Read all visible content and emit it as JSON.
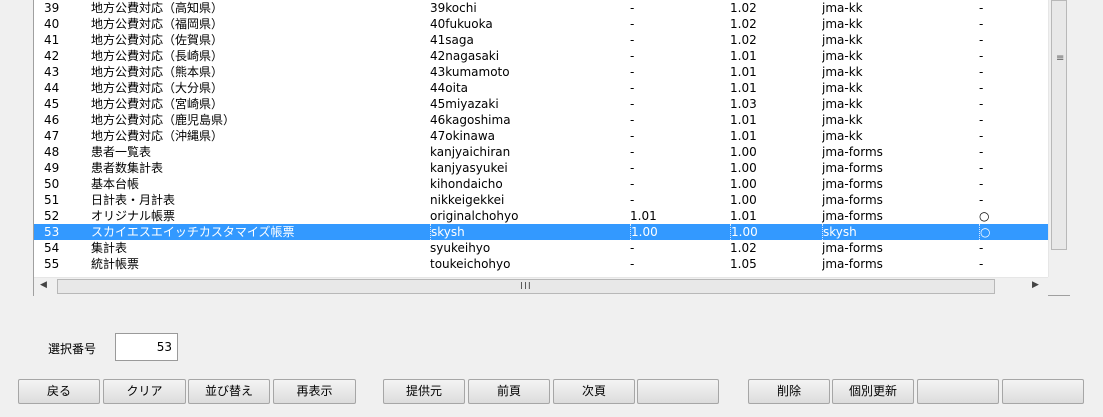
{
  "table": {
    "rows": [
      {
        "no": "39",
        "name": "地方公費対応（高知県）",
        "code": "39kochi",
        "v1": "-",
        "v2": "1.02",
        "type": "jma-kk",
        "mark": "-"
      },
      {
        "no": "40",
        "name": "地方公費対応（福岡県）",
        "code": "40fukuoka",
        "v1": "-",
        "v2": "1.02",
        "type": "jma-kk",
        "mark": "-"
      },
      {
        "no": "41",
        "name": "地方公費対応（佐賀県）",
        "code": "41saga",
        "v1": "-",
        "v2": "1.02",
        "type": "jma-kk",
        "mark": "-"
      },
      {
        "no": "42",
        "name": "地方公費対応（長崎県）",
        "code": "42nagasaki",
        "v1": "-",
        "v2": "1.01",
        "type": "jma-kk",
        "mark": "-"
      },
      {
        "no": "43",
        "name": "地方公費対応（熊本県）",
        "code": "43kumamoto",
        "v1": "-",
        "v2": "1.01",
        "type": "jma-kk",
        "mark": "-"
      },
      {
        "no": "44",
        "name": "地方公費対応（大分県）",
        "code": "44oita",
        "v1": "-",
        "v2": "1.01",
        "type": "jma-kk",
        "mark": "-"
      },
      {
        "no": "45",
        "name": "地方公費対応（宮崎県）",
        "code": "45miyazaki",
        "v1": "-",
        "v2": "1.03",
        "type": "jma-kk",
        "mark": "-"
      },
      {
        "no": "46",
        "name": "地方公費対応（鹿児島県）",
        "code": "46kagoshima",
        "v1": "-",
        "v2": "1.01",
        "type": "jma-kk",
        "mark": "-"
      },
      {
        "no": "47",
        "name": "地方公費対応（沖縄県）",
        "code": "47okinawa",
        "v1": "-",
        "v2": "1.01",
        "type": "jma-kk",
        "mark": "-"
      },
      {
        "no": "48",
        "name": "患者一覧表",
        "code": "kanjyaichiran",
        "v1": "-",
        "v2": "1.00",
        "type": "jma-forms",
        "mark": "-"
      },
      {
        "no": "49",
        "name": "患者数集計表",
        "code": "kanjyasyukei",
        "v1": "-",
        "v2": "1.00",
        "type": "jma-forms",
        "mark": "-"
      },
      {
        "no": "50",
        "name": "基本台帳",
        "code": "kihondaicho",
        "v1": "-",
        "v2": "1.00",
        "type": "jma-forms",
        "mark": "-"
      },
      {
        "no": "51",
        "name": "日計表・月計表",
        "code": "nikkeigekkei",
        "v1": "-",
        "v2": "1.00",
        "type": "jma-forms",
        "mark": "-"
      },
      {
        "no": "52",
        "name": "オリジナル帳票",
        "code": "originalchohyo",
        "v1": "1.01",
        "v2": "1.01",
        "type": "jma-forms",
        "mark": "○"
      },
      {
        "no": "53",
        "name": "スカイエスエイッチカスタマイズ帳票",
        "code": "skysh",
        "v1": "1.00",
        "v2": "1.00",
        "type": "skysh",
        "mark": "○",
        "selected": true
      },
      {
        "no": "54",
        "name": "集計表",
        "code": "syukeihyo",
        "v1": "-",
        "v2": "1.02",
        "type": "jma-forms",
        "mark": "-"
      },
      {
        "no": "55",
        "name": "統計帳票",
        "code": "toukeichohyo",
        "v1": "-",
        "v2": "1.05",
        "type": "jma-forms",
        "mark": "-"
      }
    ]
  },
  "selection": {
    "label": "選択番号",
    "value": "53"
  },
  "buttons": [
    "戻る",
    "クリア",
    "並び替え",
    "再表示",
    "提供元",
    "前頁",
    "次頁",
    "",
    "削除",
    "個別更新",
    "",
    ""
  ]
}
